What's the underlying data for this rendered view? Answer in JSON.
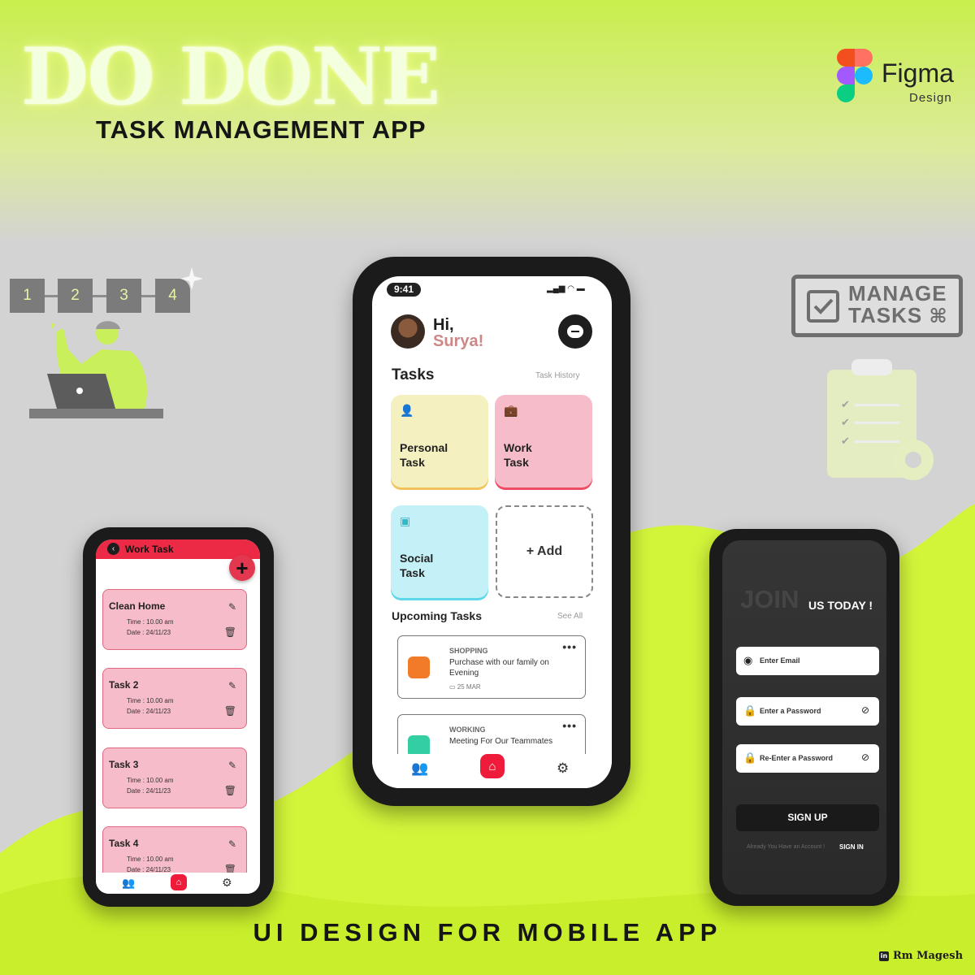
{
  "header": {
    "logo_title": "DO DONE",
    "subtitle": "TASK MANAGEMENT APP",
    "figma_word": "Figma",
    "figma_design": "Design"
  },
  "footer": {
    "title": "UI DESIGN FOR MOBILE APP",
    "credit": "Rm Magesh"
  },
  "steps": [
    "1",
    "2",
    "3",
    "4"
  ],
  "badge": {
    "line1": "MANAGE",
    "line2": "TASKS"
  },
  "colors": {
    "accent_lime": "#d6f53a",
    "brand_red": "#ee1c3a",
    "personal": "#f5f0c0",
    "work": "#f7bcc9",
    "social": "#c4f0f7"
  },
  "center": {
    "status_time": "9:41",
    "greeting": "Hi,",
    "user_name": "Surya!",
    "tasks_title": "Tasks",
    "task_history": "Task History",
    "cards": [
      {
        "line1": "Personal",
        "line2": "Task",
        "icon": "person-icon"
      },
      {
        "line1": "Work",
        "line2": "Task",
        "icon": "briefcase-icon"
      },
      {
        "line1": "Social",
        "line2": "Task",
        "icon": "social-icon"
      }
    ],
    "add_label": "+ Add",
    "upcoming_title": "Upcoming Tasks",
    "see_all": "See All",
    "upcoming": [
      {
        "category": "SHOPPING",
        "desc": "Purchase with our family on Evening",
        "date": "25 MAR"
      },
      {
        "category": "WORKING",
        "desc": "Meeting For Our Teammates"
      }
    ]
  },
  "left": {
    "title": "Work Task",
    "fab_label": "+",
    "tasks": [
      {
        "name": "Clean Home",
        "time": "Time : 10.00 am",
        "date": "Date : 24/11/23"
      },
      {
        "name": "Task 2",
        "time": "Time : 10.00 am",
        "date": "Date : 24/11/23"
      },
      {
        "name": "Task 3",
        "time": "Time : 10.00 am",
        "date": "Date : 24/11/23"
      },
      {
        "name": "Task 4",
        "time": "Time : 10.00 am",
        "date": "Date : 24/11/23"
      }
    ]
  },
  "right": {
    "join": "JOIN",
    "join_sub": "US TODAY !",
    "email_placeholder": "Enter Email",
    "password_placeholder": "Enter a Password",
    "reenter_placeholder": "Re-Enter a Password",
    "signup_label": "SIGN UP",
    "already_text": "Already You Have an Account !",
    "signin_label": "SIGN IN"
  }
}
